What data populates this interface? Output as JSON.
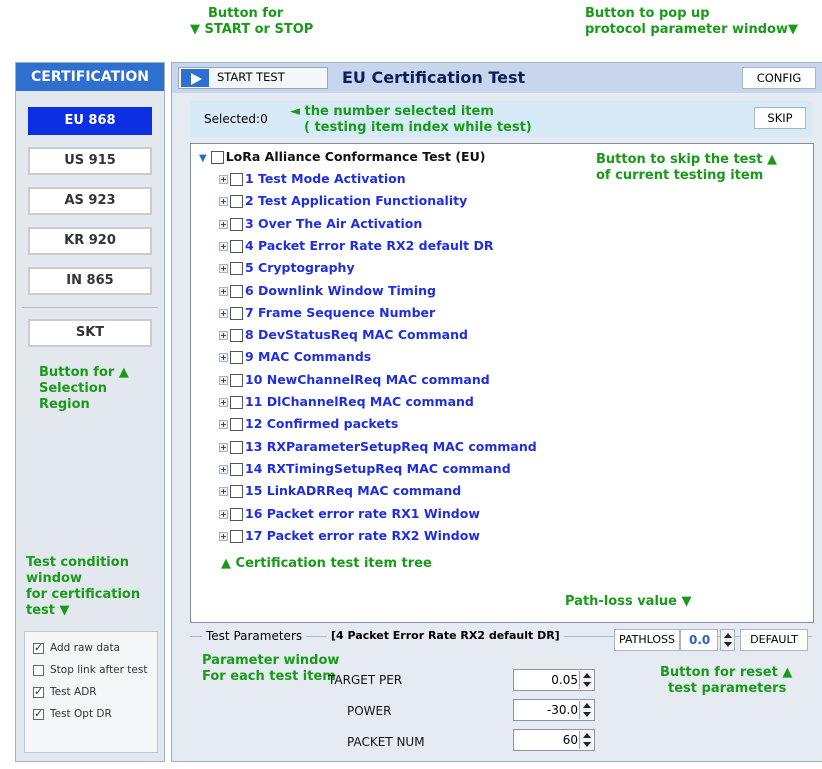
{
  "annotations": {
    "start_stop_line1": "Button for",
    "start_stop_line2": "▼ START or STOP",
    "config_line1": "Button to pop up",
    "config_line2": "protocol parameter window▼",
    "selected_line1": "◄ the number selected item",
    "selected_line2": "( testing item index while test)",
    "skip_line1": "Button to skip  the test ▲",
    "skip_line2": "of  current  testing item",
    "region_line1": "Button for ▲",
    "region_line2": "Selection",
    "region_line3": "Region",
    "cond_line1": "Test condition",
    "cond_line2": "window",
    "cond_line3": "for certification",
    "cond_line4": "test ▼",
    "tree_note": "▲ Certification  test item tree",
    "pathloss_note": "Path-loss value ▼",
    "param_line1": "Parameter window",
    "param_line2": "For each test item",
    "reset_line1": "Button for reset ▲",
    "reset_line2": "test parameters"
  },
  "sidebar": {
    "title": "CERTIFICATION",
    "regions": [
      "EU 868",
      "US 915",
      "AS 923",
      "KR 920",
      "IN 865"
    ],
    "skt": "SKT",
    "conditions": [
      {
        "label": "Add raw data",
        "checked": true
      },
      {
        "label": "Stop link after test",
        "checked": false
      },
      {
        "label": "Test ADR",
        "checked": true
      },
      {
        "label": "Test Opt DR",
        "checked": true
      }
    ]
  },
  "header": {
    "start_label": "START TEST",
    "title": "EU Certification Test",
    "config_label": "CONFIG"
  },
  "selection": {
    "text": "Selected:0",
    "skip_label": "SKIP"
  },
  "tree": {
    "root": "LoRa Alliance Conformance Test (EU)",
    "items": [
      "1 Test Mode Activation",
      "2 Test Application Functionality",
      "3 Over The Air Activation",
      "4 Packet Error Rate RX2 default DR",
      "5 Cryptography",
      "6 Downlink Window Timing",
      "7 Frame Sequence Number",
      "8 DevStatusReq MAC Command",
      "9 MAC Commands",
      "10 NewChannelReq MAC command",
      "11 DlChannelReq MAC command",
      "12 Confirmed packets",
      "13 RXParameterSetupReq MAC command",
      "14 RXTimingSetupReq MAC command",
      "15 LinkADRReq MAC command",
      "16 Packet error rate RX1 Window",
      "17 Packet error rate RX2 Window"
    ]
  },
  "params": {
    "legend": "Test Parameters",
    "current": "[4 Packet Error Rate RX2 default DR]",
    "pathloss_label": "PATHLOSS",
    "pathloss_value": "0.0",
    "default_label": "DEFAULT",
    "fields": [
      {
        "label": "TARGET PER",
        "value": "0.05"
      },
      {
        "label": "POWER",
        "value": "-30.0"
      },
      {
        "label": "PACKET NUM",
        "value": "60"
      }
    ]
  }
}
